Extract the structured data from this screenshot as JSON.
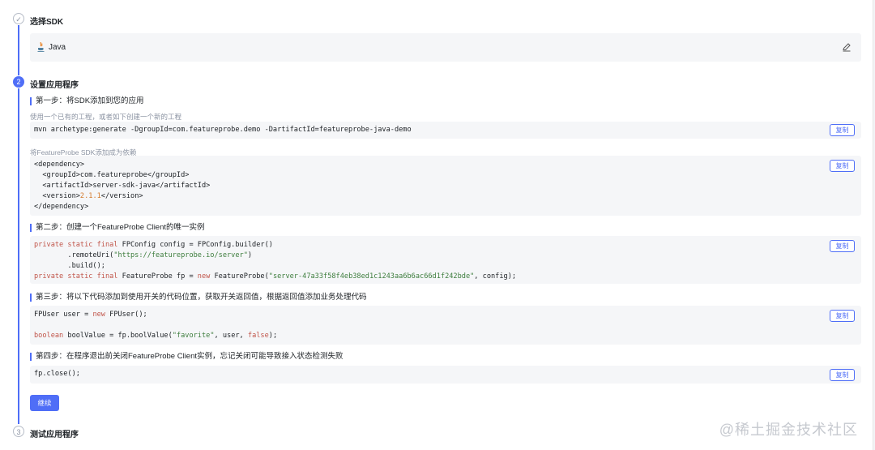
{
  "steps": [
    {
      "number": "✓",
      "title": "选择SDK"
    },
    {
      "number": "2",
      "title": "设置应用程序"
    },
    {
      "number": "3",
      "title": "测试应用程序"
    }
  ],
  "sdk": {
    "name": "Java",
    "icon": "java-icon",
    "edit_icon": "edit-pencil-icon"
  },
  "setup": {
    "step1": {
      "title": "第一步：将SDK添加到您的应用",
      "hint1": "使用一个已有的工程，或者如下创建一个新的工程",
      "code1": "mvn archetype:generate -DgroupId=com.featureprobe.demo -DartifactId=featureprobe-java-demo",
      "hint2": "将FeatureProbe SDK添加成为依赖",
      "code2": {
        "l1": "<dependency>",
        "l2": "  <groupId>com.featureprobe</groupId>",
        "l3": "  <artifactId>server-sdk-java</artifactId>",
        "l4a": "  <version>",
        "l4b": "2.1.1",
        "l4c": "</version>",
        "l5": "</dependency>"
      }
    },
    "step2": {
      "title": "第二步：创建一个FeatureProbe Client的唯一实例",
      "l1a": "private static final",
      "l1b": " FPConfig config = FPConfig.builder()",
      "l2a": "        .remoteUri(",
      "l2b": "\"https://featureprobe.io/server\"",
      "l2c": ")",
      "l3": "        .build();",
      "l4a": "private static final",
      "l4b": " FeatureProbe fp = ",
      "l4c": "new",
      "l4d": " FeatureProbe(",
      "l4e": "\"server-47a33f58f4eb38ed1c1243aa6b6ac66d1f242bde\"",
      "l4f": ", config);"
    },
    "step3": {
      "title": "第三步：将以下代码添加到使用开关的代码位置，获取开关返回值，根据返回值添加业务处理代码",
      "l1a": "FPUser user = ",
      "l1b": "new",
      "l1c": " FPUser();",
      "l2a": "boolean",
      "l2b": " boolValue = fp.boolValue(",
      "l2c": "\"favorite\"",
      "l2d": ", user, ",
      "l2e": "false",
      "l2f": ");"
    },
    "step4": {
      "title": "第四步：在程序退出前关闭FeatureProbe Client实例，忘记关闭可能导致接入状态检测失败",
      "code": "fp.close();"
    },
    "copy_label": "复制",
    "continue_label": "继续"
  },
  "watermark": "@稀土掘金技术社区",
  "colors": {
    "accent": "#4f6ef7",
    "keyword": "#c1554a",
    "string": "#3d7d3d",
    "number": "#d47b2e"
  }
}
